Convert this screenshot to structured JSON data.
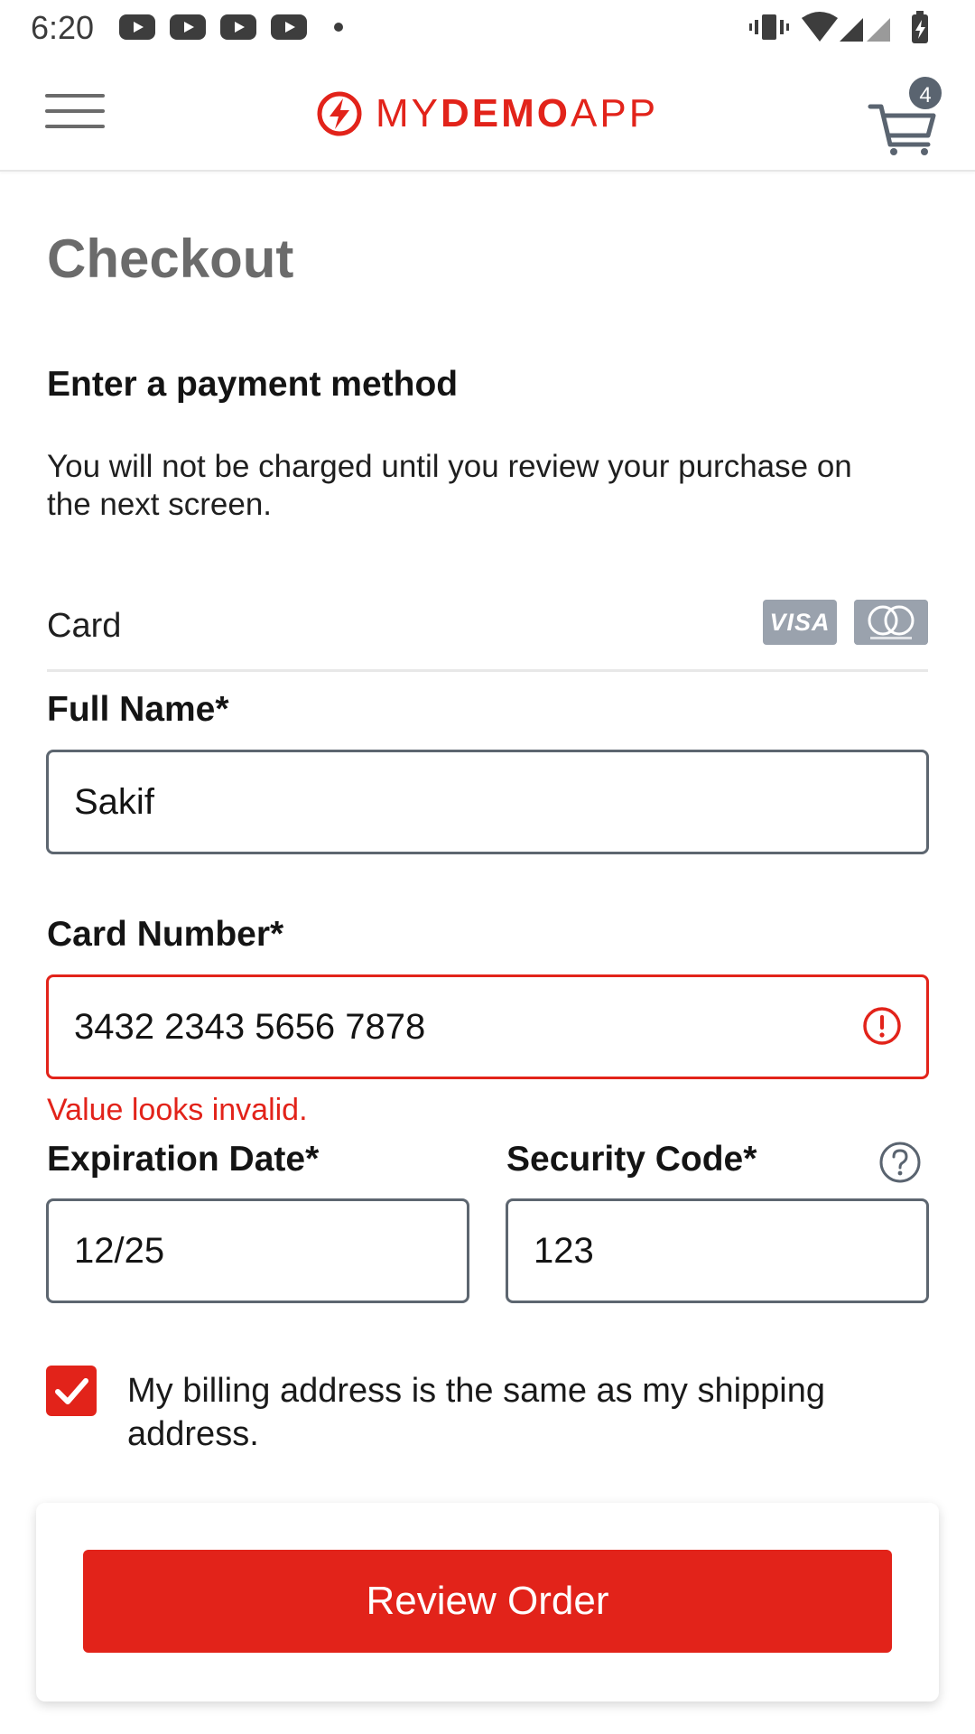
{
  "status_bar": {
    "time": "6:20",
    "notification_icons": [
      "youtube-icon",
      "youtube-icon",
      "youtube-icon",
      "youtube-icon"
    ],
    "system_icons": [
      "vibrate-icon",
      "wifi-icon",
      "signal-icon",
      "signal-icon",
      "battery-charging-icon"
    ]
  },
  "header": {
    "logo_text_thin1": "MY",
    "logo_text_bold": "DEMO",
    "logo_text_thin2": "APP",
    "cart_count": "4"
  },
  "checkout": {
    "title": "Checkout",
    "section_title": "Enter a payment method",
    "section_subtitle": "You will not be charged until you review your purchase on the next screen.",
    "card_label": "Card",
    "visa_label": "VISA",
    "full_name_label": "Full Name*",
    "full_name_value": "Sakif",
    "card_number_label": "Card Number*",
    "card_number_value": "3432 2343 5656 7878",
    "card_number_error": "Value looks invalid.",
    "expiration_label": "Expiration Date*",
    "expiration_value": "12/25",
    "security_label": "Security Code*",
    "security_value": "123",
    "billing_checkbox_checked": true,
    "billing_checkbox_label": "My billing address is the same as my shipping address.",
    "review_button_label": "Review Order"
  },
  "colors": {
    "brand_red": "#e2231a",
    "input_border": "#5d6670",
    "title_gray": "#6b6b6b"
  }
}
